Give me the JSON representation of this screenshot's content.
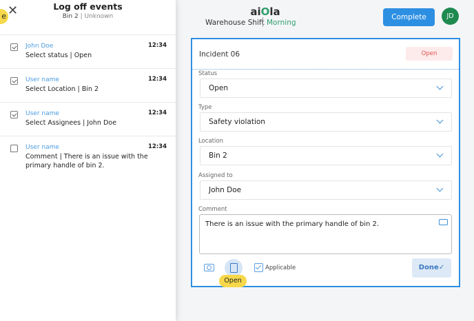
{
  "panel": {
    "highlight_letter": "e",
    "title": "Log off events",
    "subtitle_location": "Bin 2",
    "subtitle_sep": " | ",
    "subtitle_status": "Unknown"
  },
  "events": [
    {
      "user": "John Doe",
      "time": "12:34",
      "text": "Select status | Open",
      "icon": "checkbox-icon"
    },
    {
      "user": "User name",
      "time": "12:34",
      "text": "Select Location | Bin 2",
      "icon": "checkbox-icon"
    },
    {
      "user": "User name",
      "time": "12:34",
      "text": "Select Assignees | John Doe",
      "icon": "checkbox-icon"
    },
    {
      "user": "User name",
      "time": "12:34",
      "text": "Comment | There is an issue with the primary handle of bin 2.",
      "icon": "comment-icon"
    }
  ],
  "header": {
    "brand_a": "ai",
    "brand_b": "O",
    "brand_c": "la",
    "shift": "Warehouse Shift",
    "shift_time": "Morning",
    "complete_label": "Complete",
    "avatar_initials": "JD"
  },
  "incident": {
    "title": "Incident 06",
    "status_badge": "Open",
    "fields": [
      {
        "label": "Status",
        "value": "Open"
      },
      {
        "label": "Type",
        "value": "Safety violation"
      },
      {
        "label": "Location",
        "value": "Bin 2"
      },
      {
        "label": "Assigned to",
        "value": "John Doe"
      }
    ],
    "comment_label": "Comment",
    "comment_value": "There is an issue with the primary handle of bin 2.",
    "applicable_label": "Applicable",
    "done_label": "Done",
    "done_check": "✓",
    "tooltip_label": "Open"
  },
  "colors": {
    "accent_blue": "#2d8fe2",
    "brand_green": "#2e9e6b",
    "avatar_green": "#1f8a4f",
    "status_red": "#e05252",
    "highlight_yellow": "#f6d84a"
  }
}
